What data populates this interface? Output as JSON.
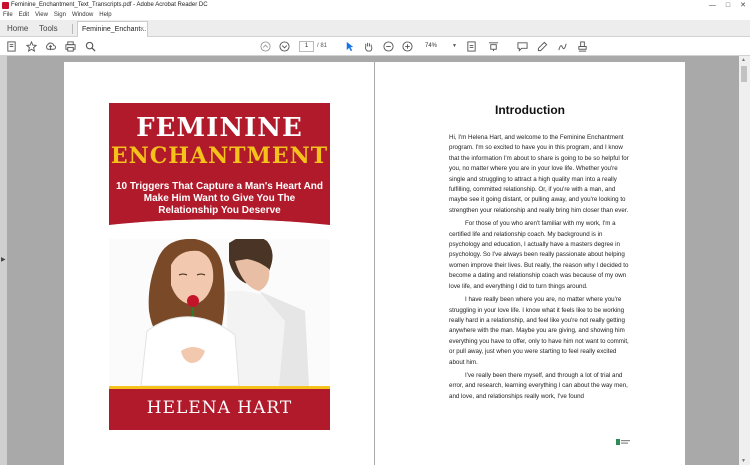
{
  "window": {
    "title": "Feminine_Enchantment_Text_Transcripts.pdf - Adobe Acrobat Reader DC"
  },
  "menu": [
    "File",
    "Edit",
    "View",
    "Sign",
    "Window",
    "Help"
  ],
  "tabs": {
    "home": "Home",
    "tools": "Tools",
    "document": "Feminine_Enchant...",
    "close": "×"
  },
  "toolbar": {
    "page_current": "1",
    "page_total": "/ 81",
    "zoom": "74%"
  },
  "cover": {
    "title_line1": "FEMININE",
    "title_line2": "ENCHANTMENT",
    "subtitle": "10 Triggers That Capture a Man's Heart And Make Him Want to Give You The Relationship You Deserve",
    "author": "HELENA HART"
  },
  "intro": {
    "heading": "Introduction",
    "paragraphs": [
      "Hi, I'm Helena Hart, and welcome to the Feminine Enchantment program. I'm so excited to have you in this program, and I know that the information I'm about to share is going to be so helpful for you, no matter where you are in your love life. Whether you're single and struggling to attract a high quality man into a really fulfilling, committed relationship. Or, if you're with a man, and maybe see it going distant, or pulling away, and you're looking to strengthen your relationship and really bring him closer than ever.",
      "For those of you who aren't familiar with my work, I'm a certified life and relationship coach. My background is in psychology and education, I actually have a masters degree in psychology. So I've always been really passionate about helping women improve their lives. But really, the reason why I decided to become a dating and relationship coach was because of my own love life, and everything I did to turn things around.",
      "I have really been where you are, no matter where you're struggling in your love life. I know what it feels like to be working really hard in a relationship, and feel like you're not really getting anywhere with the man. Maybe you are giving, and showing him everything you have to offer, only to have him not want to commit, or pull away, just when you were starting to feel really excited about him.",
      "I've really been there myself, and through a lot of trial and error, and research, learning everything I can about the way men, and love, and relationships really work, I've found"
    ]
  },
  "colors": {
    "cover_red": "#b11a2b",
    "cover_gold": "#f4c21a",
    "doc_bg": "#a9a9a9",
    "tool_blue": "#1473e6"
  }
}
